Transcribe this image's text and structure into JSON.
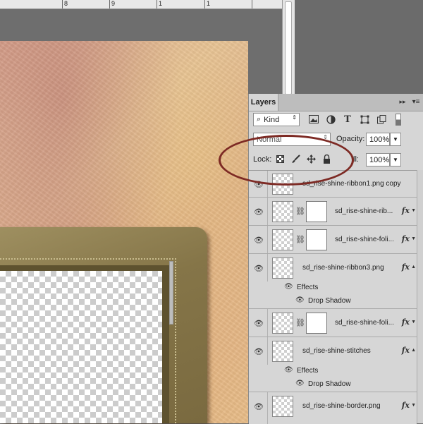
{
  "ruler": {
    "numbers": [
      {
        "label": "8",
        "pos": 0
      },
      {
        "label": "9",
        "pos": 1
      },
      {
        "label": "1",
        "pos": 2
      },
      {
        "label": "1",
        "pos": 3
      }
    ]
  },
  "panel": {
    "tab_label": "Layers",
    "collapse_glyph": "▸▸",
    "menu_glyph": "▾≡",
    "filter": {
      "kind_label": "Kind",
      "kind_icon": "search-icon",
      "icons": [
        "image-filter-icon",
        "adjustment-filter-icon",
        "type-filter-icon",
        "shape-filter-icon",
        "smart-object-filter-icon"
      ]
    },
    "blend_mode": "Normal",
    "opacity_label": "Opacity:",
    "opacity_value": "100%",
    "lock_label": "Lock:",
    "lock_icons": [
      "lock-transparent-icon",
      "lock-brush-icon",
      "lock-move-icon",
      "lock-all-icon"
    ],
    "fill_label": "ll:",
    "fill_value": "100%"
  },
  "layers": [
    {
      "name": "sd_rise-shine-ribbon1.png copy",
      "has_mask": false,
      "fx": false,
      "effects": []
    },
    {
      "name": "sd_rise-shine-rib...",
      "has_mask": true,
      "fx": true,
      "effects": []
    },
    {
      "name": "sd_rise-shine-foli...",
      "has_mask": true,
      "fx": true,
      "effects": []
    },
    {
      "name": "sd_rise-shine-ribbon3.png",
      "has_mask": false,
      "fx": true,
      "effects": [
        "Effects",
        "Drop Shadow"
      ]
    },
    {
      "name": "sd_rise-shine-foli...",
      "has_mask": true,
      "fx": true,
      "effects": []
    },
    {
      "name": "sd_rise-shine-stitches",
      "has_mask": false,
      "fx": true,
      "effects": [
        "Effects",
        "Drop Shadow"
      ]
    },
    {
      "name": "sd_rise-shine-border.png",
      "has_mask": false,
      "fx": true,
      "effects": []
    }
  ],
  "fx_label": "fx",
  "annotation_color": "#7d2a24"
}
